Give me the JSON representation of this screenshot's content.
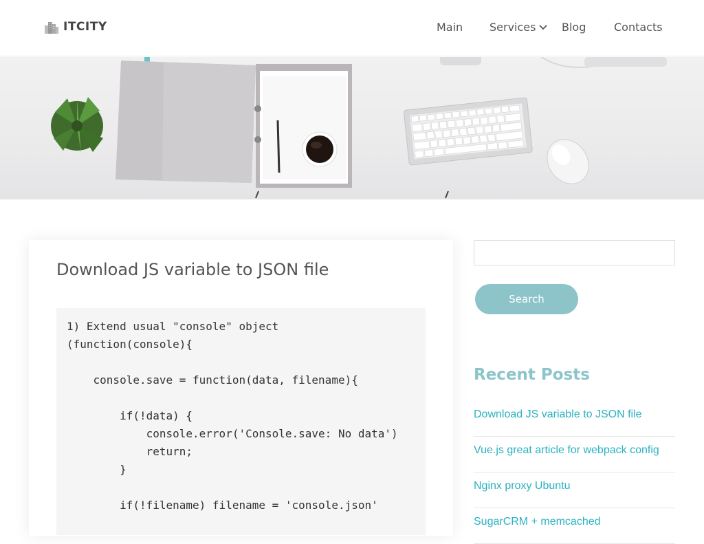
{
  "header": {
    "logo_text": "ITCITY",
    "nav": [
      {
        "label": "Main"
      },
      {
        "label": "Services"
      },
      {
        "label": "Blog"
      },
      {
        "label": "Contacts"
      }
    ]
  },
  "post": {
    "title": "Download JS variable to JSON file",
    "code": "1) Extend usual \"console\" object\n(function(console){\n\n    console.save = function(data, filename){\n\n        if(!data) {\n            console.error('Console.save: No data')\n            return;\n        }\n\n        if(!filename) filename = 'console.json'"
  },
  "sidebar": {
    "search_placeholder": "",
    "search_label": "Search",
    "recent_title": "Recent Posts",
    "recent_posts": [
      {
        "label": "Download JS variable to JSON file"
      },
      {
        "label": "Vue.js great article for webpack config"
      },
      {
        "label": "Nginx proxy Ubuntu"
      },
      {
        "label": "SugarCRM + memcached"
      }
    ]
  },
  "colors": {
    "accent": "#8cc4c9",
    "link": "#2ab1c2"
  }
}
